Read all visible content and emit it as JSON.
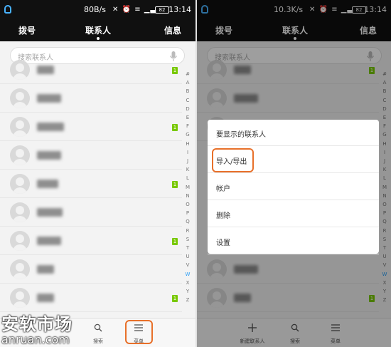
{
  "left": {
    "status": {
      "speed": "80B/s",
      "icons": "✕ ⏰ ≡ ▁▃",
      "battery": "82",
      "time": "13:14"
    },
    "tabs": [
      "拨号",
      "联系人",
      "信息"
    ],
    "search_placeholder": "搜索联系人",
    "contacts": [
      {
        "partial": true,
        "sim": "1"
      },
      {
        "sim": ""
      },
      {
        "sim": "1"
      },
      {
        "sim": ""
      },
      {
        "sim": "1"
      },
      {
        "sim": ""
      },
      {
        "sim": "1"
      },
      {
        "sim": ""
      },
      {
        "sim": "1"
      }
    ],
    "alphabet": [
      "#",
      "A",
      "B",
      "C",
      "D",
      "E",
      "F",
      "G",
      "H",
      "I",
      "J",
      "K",
      "L",
      "M",
      "N",
      "O",
      "P",
      "Q",
      "R",
      "S",
      "T",
      "U",
      "V",
      "W",
      "X",
      "Y",
      "Z"
    ],
    "bottom": {
      "search_label": "搜索",
      "menu_label": "菜单"
    }
  },
  "right": {
    "status": {
      "speed": "10.3K/s",
      "icons": "✕ ⏰ ≡ ▁▃",
      "battery": "82",
      "time": "13:14"
    },
    "tabs": [
      "拨号",
      "联系人",
      "信息"
    ],
    "search_placeholder": "搜索联系人",
    "menu": [
      "要显示的联系人",
      "导入/导出",
      "帐户",
      "删除",
      "设置"
    ],
    "bottom": {
      "new_label": "新建联系人",
      "search_label": "搜索",
      "menu_label": "菜单"
    }
  },
  "watermark": {
    "cn": "安软市场",
    "en": "anruan.com"
  },
  "colors": {
    "highlight": "#e8702a",
    "sim_badge": "#78c800",
    "status_bg": "#101010",
    "alpha_active": "#2a9df4"
  }
}
